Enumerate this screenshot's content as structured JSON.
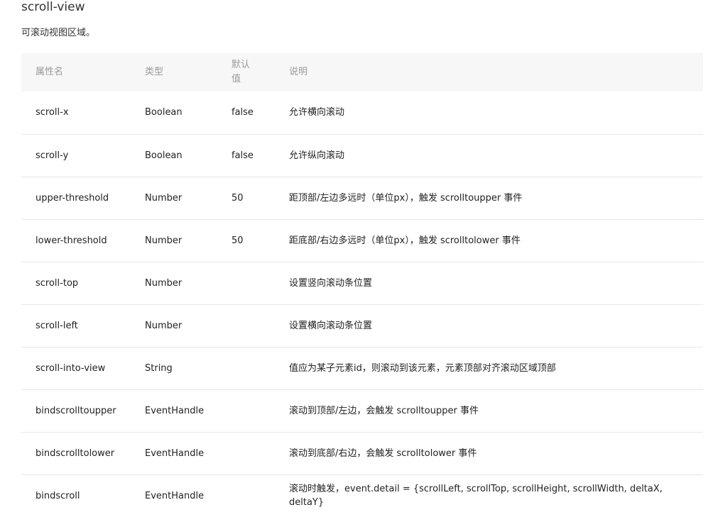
{
  "page": {
    "title": "scroll-view",
    "description": "可滚动视图区域。"
  },
  "table": {
    "headers": [
      "属性名",
      "类型",
      "默认值",
      "说明"
    ],
    "rows": [
      {
        "name": "scroll-x",
        "type": "Boolean",
        "default": "false",
        "desc": "允许横向滚动"
      },
      {
        "name": "scroll-y",
        "type": "Boolean",
        "default": "false",
        "desc": "允许纵向滚动"
      },
      {
        "name": "upper-threshold",
        "type": "Number",
        "default": "50",
        "desc": "距顶部/左边多远时（单位px），触发 scrolltoupper 事件"
      },
      {
        "name": "lower-threshold",
        "type": "Number",
        "default": "50",
        "desc": "距底部/右边多远时（单位px），触发 scrolltolower 事件"
      },
      {
        "name": "scroll-top",
        "type": "Number",
        "default": "",
        "desc": "设置竖向滚动条位置"
      },
      {
        "name": "scroll-left",
        "type": "Number",
        "default": "",
        "desc": "设置横向滚动条位置"
      },
      {
        "name": "scroll-into-view",
        "type": "String",
        "default": "",
        "desc": "值应为某子元素id，则滚动到该元素，元素顶部对齐滚动区域顶部"
      },
      {
        "name": "bindscrolltoupper",
        "type": "EventHandle",
        "default": "",
        "desc": "滚动到顶部/左边，会触发 scrolltoupper 事件"
      },
      {
        "name": "bindscrolltolower",
        "type": "EventHandle",
        "default": "",
        "desc": "滚动到底部/右边，会触发 scrolltolower 事件"
      },
      {
        "name": "bindscroll",
        "type": "EventHandle",
        "default": "",
        "desc": "滚动时触发，event.detail = {scrollLeft, scrollTop, scrollHeight, scrollWidth, deltaX, deltaY}"
      }
    ]
  }
}
